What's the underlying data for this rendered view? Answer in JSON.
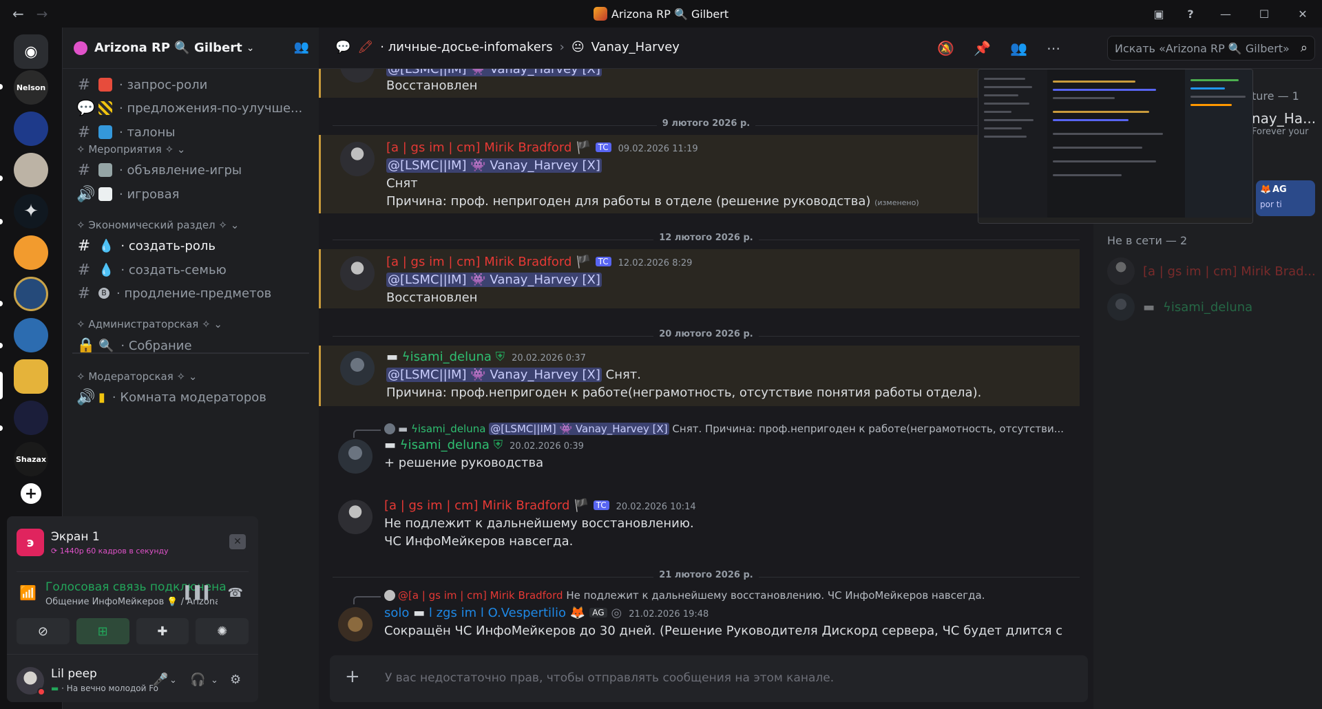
{
  "window": {
    "title": "Arizona RP 🔍 Gilbert"
  },
  "server_rail": {
    "items": [
      {
        "name": "Discord",
        "label": "",
        "color": "#5865f2"
      },
      {
        "name": "Nelson",
        "label": "Nelson",
        "color": "#2a2a2a"
      },
      {
        "name": "Server A",
        "label": "",
        "color": "#1e3a8a"
      },
      {
        "name": "Server B",
        "label": "",
        "color": "#bcb3a5"
      },
      {
        "name": "Server C",
        "label": "",
        "color": "#101820"
      },
      {
        "name": "Server D",
        "label": "",
        "color": "#f29b2e"
      },
      {
        "name": "Server E",
        "label": "",
        "color": "#254a7a"
      },
      {
        "name": "Server F",
        "label": "",
        "color": "#2c6cb0"
      },
      {
        "name": "Server G",
        "label": "",
        "color": "#e5b33a"
      },
      {
        "name": "Server H",
        "label": "",
        "color": "#1b1e3a"
      },
      {
        "name": "Shazax",
        "label": "Shazax",
        "color": "#1a1a1a"
      }
    ]
  },
  "sidebar": {
    "guild_name": "Arizona RP 🔍 Gilbert",
    "channels_top": [
      {
        "label": "· запрос-роли",
        "type": "text"
      },
      {
        "label": "· предложения-по-улучше...",
        "type": "forum"
      },
      {
        "label": "· талоны",
        "type": "text"
      }
    ],
    "categories": [
      {
        "label": "✧ Мероприятия ✧",
        "channels": [
          {
            "label": "· объявление-игры",
            "type": "text"
          },
          {
            "label": "· игровая",
            "type": "voice"
          }
        ]
      },
      {
        "label": "✧ Экономический раздел ✧",
        "channels": [
          {
            "label": "· создать-роль",
            "type": "text",
            "active": true
          },
          {
            "label": "· создать-семью",
            "type": "text"
          },
          {
            "label": "· продление-предметов",
            "type": "text"
          }
        ]
      },
      {
        "label": "✧ Администраторская ✧",
        "channels": [
          {
            "label": "· Собрание",
            "type": "locked"
          }
        ]
      },
      {
        "label": "✧ Модераторская ✧",
        "channels": [
          {
            "label": "· Комната модераторов",
            "type": "voice"
          }
        ]
      }
    ]
  },
  "panel": {
    "stream_title": "Экран 1",
    "stream_sub": "1440p 60 кадров в секунду",
    "voice_status": "Голосовая связь подключена",
    "voice_channel": "Общение ИнфоМейкеров 💡 / Arizona ...",
    "user_name": "Lil peep",
    "user_status": "· На вечно молодой Fo"
  },
  "chat_header": {
    "channel": "· личные-досье-infomakers",
    "thread": "Vanay_Harvey",
    "search_placeholder": "Искать «Arizona RP 🔍 Gilbert»"
  },
  "messages": {
    "m0_mention": "@[LSMC||IM] 👾 Vanay_Harvey [X]",
    "m0_text": "Восстановлен",
    "d1": "9 лютого 2026 р.",
    "m1_author": "[a | gs im | cm] Mirik Bradford",
    "m1_tag": "TC",
    "m1_ts": "09.02.2026 11:19",
    "m1_mention": "@[LSMC||IM] 👾 Vanay_Harvey [X]",
    "m1_text1": "Снят",
    "m1_text2": "Причина: проф. непригоден для работы в отделе (решение руководства)",
    "m1_edited": "(изменено)",
    "d2": "12 лютого 2026 р.",
    "m2_author": "[a | gs im | cm] Mirik Bradford",
    "m2_tag": "TC",
    "m2_ts": "12.02.2026 8:29",
    "m2_mention": "@[LSMC||IM] 👾 Vanay_Harvey [X]",
    "m2_text": "Восстановлен",
    "d3": "20 лютого 2026 р.",
    "m3_author": "ϟisami_deluna",
    "m3_ts": "20.02.2026 0:37",
    "m3_mention": "@[LSMC||IM] 👾 Vanay_Harvey [X]",
    "m3_text1": " Снят.",
    "m3_text2": "Причина: проф.непригоден к работе(неграмотность, отсутствие понятия работы отдела).",
    "m4_reply_author": "ϟisami_deluna",
    "m4_reply_mention": "@[LSMC||IM] 👾 Vanay_Harvey [X]",
    "m4_reply_text": " Снят. Причина: проф.непригоден к работе(неграмотность, отсутстви...",
    "m4_author": "ϟisami_deluna",
    "m4_ts": "20.02.2026 0:39",
    "m4_text": "+ решение руководства",
    "m5_author": "[a | gs im | cm] Mirik Bradford",
    "m5_tag": "TC",
    "m5_ts": "20.02.2026 10:14",
    "m5_text1": "Не подлежит к дальнейшему восстановлению.",
    "m5_text2": "ЧС ИнфоМейкеров навсегда.",
    "d4": "21 лютого 2026 р.",
    "m6_reply_author": "@[a | gs im | cm] Mirik Bradford",
    "m6_reply_text": "Не подлежит к дальнейшему восстановлению.  ЧС ИнфоМейкеров навсегда.",
    "m6_author_prefix": "solo",
    "m6_author": "l zgs im l O.Vespertilio",
    "m6_tag": "AG",
    "m6_ts": "21.02.2026 19:48",
    "m6_text": "Сокращён ЧС ИнфоМейкеров до 30 дней. (Решение Руководителя Дискорд сервера, ЧС будет длится с"
  },
  "composer": {
    "placeholder": "У вас недостаточно прав, чтобы отправлять сообщения на этом канале."
  },
  "members": {
    "partial_cat": "ture — 1",
    "partial_name": "nay_Ha...",
    "partial_status": "Forever your",
    "partial_card_tag": "AG",
    "partial_card_sub": "por ti",
    "offline_cat": "Не в сети — 2",
    "offline": [
      {
        "name": "[a | gs im | cm] Mirik Brad..."
      },
      {
        "name": "ϟisami_deluna"
      }
    ]
  }
}
